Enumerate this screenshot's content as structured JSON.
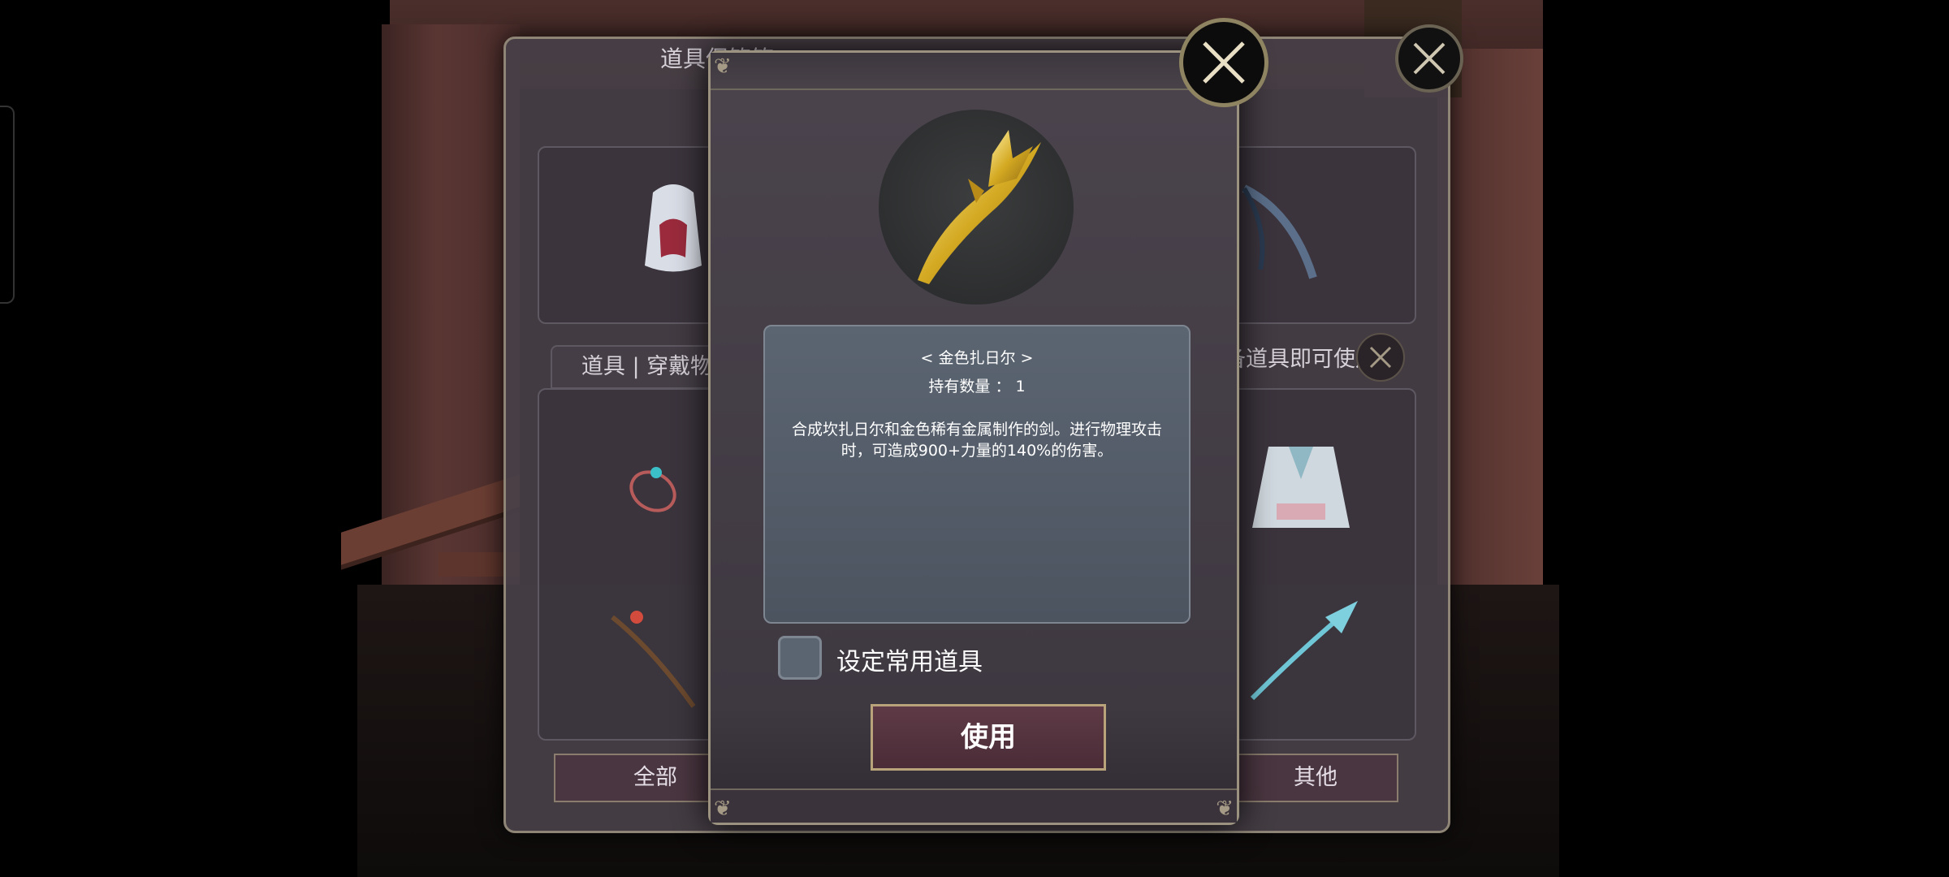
{
  "back_panel": {
    "title": "道具保管箱",
    "tab_label": "道具 | 穿戴物品",
    "hint": "装备道具即可使用",
    "bottom_tabs": {
      "all": "全部",
      "other": "其他"
    }
  },
  "dialog": {
    "item_name": "< 金色扎日尔 >",
    "quantity_label": "持有数量 ： 1",
    "description": "合成坎扎日尔和金色稀有金属制作的剑。进行物理攻击时，可造成900+力量的140%的伤害。",
    "checkbox_label": "设定常用道具",
    "use_button": "使用"
  },
  "icons": {
    "close": "close-x-icon",
    "item": "golden-sword-icon"
  },
  "colors": {
    "accent_gold": "#b8a37a",
    "button_bg": "#4a2c37",
    "desc_box_bg": "#5b6571"
  }
}
